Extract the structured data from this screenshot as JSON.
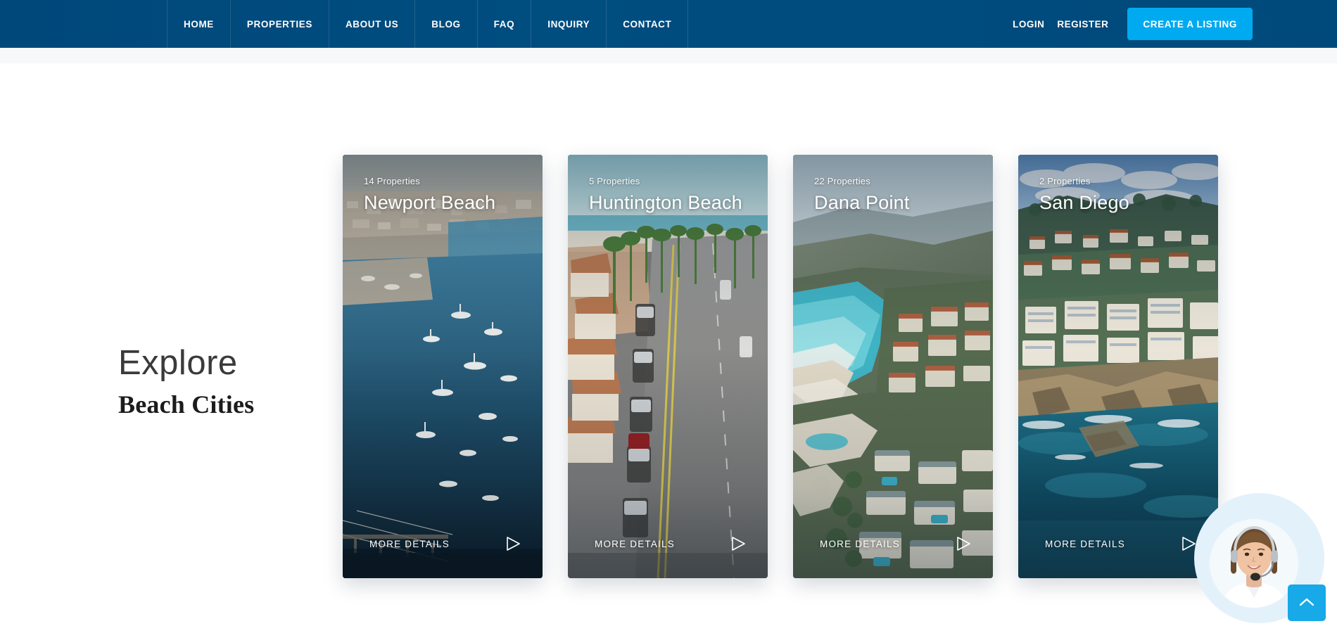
{
  "nav": {
    "links": [
      {
        "label": "HOME"
      },
      {
        "label": "PROPERTIES"
      },
      {
        "label": "ABOUT US"
      },
      {
        "label": "BLOG"
      },
      {
        "label": "FAQ"
      },
      {
        "label": "INQUIRY"
      },
      {
        "label": "CONTACT"
      }
    ],
    "login_label": "LOGIN",
    "register_label": "REGISTER",
    "cta_label": "CREATE A LISTING",
    "bar_color": "#004a7c",
    "cta_color": "#00aaf0"
  },
  "section": {
    "heading_line1": "Explore",
    "heading_line2": "Beach Cities"
  },
  "cards": [
    {
      "count_label": "14 Properties",
      "title": "Newport Beach",
      "cta_label": "MORE DETAILS",
      "play_icon": "play-triangle-icon"
    },
    {
      "count_label": "5 Properties",
      "title": "Huntington Beach",
      "cta_label": "MORE DETAILS",
      "play_icon": "play-triangle-icon"
    },
    {
      "count_label": "22 Properties",
      "title": "Dana Point",
      "cta_label": "MORE DETAILS",
      "play_icon": "play-triangle-icon"
    },
    {
      "count_label": "2 Properties",
      "title": "San Diego",
      "cta_label": "MORE DETAILS",
      "play_icon": "play-triangle-icon"
    }
  ],
  "support": {
    "avatar_icon": "support-agent-headset-avatar",
    "scroll_top_icon": "chevron-up-icon",
    "scroll_top_color": "#17a9e8",
    "blob_color": "#e3f1fb"
  }
}
